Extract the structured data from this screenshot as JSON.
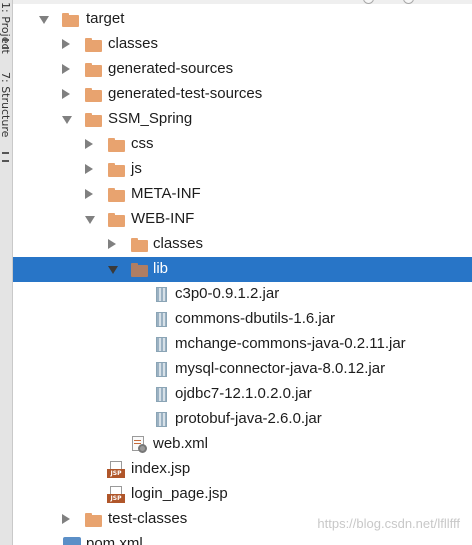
{
  "side_panel": {
    "project_tab": "1: Project",
    "structure_tab": "7: Structure"
  },
  "tree": [
    {
      "label": "target",
      "icon": "folder-icon",
      "state": "expanded"
    },
    {
      "label": "classes",
      "icon": "folder-icon",
      "state": "collapsed"
    },
    {
      "label": "generated-sources",
      "icon": "folder-icon",
      "state": "collapsed"
    },
    {
      "label": "generated-test-sources",
      "icon": "folder-icon",
      "state": "collapsed"
    },
    {
      "label": "SSM_Spring",
      "icon": "folder-icon",
      "state": "expanded"
    },
    {
      "label": "css",
      "icon": "folder-icon",
      "state": "collapsed"
    },
    {
      "label": "js",
      "icon": "folder-icon",
      "state": "collapsed"
    },
    {
      "label": "META-INF",
      "icon": "folder-icon",
      "state": "collapsed"
    },
    {
      "label": "WEB-INF",
      "icon": "folder-icon",
      "state": "expanded"
    },
    {
      "label": "classes",
      "icon": "folder-icon",
      "state": "collapsed"
    },
    {
      "label": "lib",
      "icon": "folder-icon",
      "state": "expanded",
      "selected": true
    },
    {
      "label": "c3p0-0.9.1.2.jar",
      "icon": "jar-icon"
    },
    {
      "label": "commons-dbutils-1.6.jar",
      "icon": "jar-icon"
    },
    {
      "label": "mchange-commons-java-0.2.11.jar",
      "icon": "jar-icon"
    },
    {
      "label": "mysql-connector-java-8.0.12.jar",
      "icon": "jar-icon"
    },
    {
      "label": "ojdbc7-12.1.0.2.0.jar",
      "icon": "jar-icon"
    },
    {
      "label": "protobuf-java-2.6.0.jar",
      "icon": "jar-icon"
    },
    {
      "label": "web.xml",
      "icon": "xml-file-icon"
    },
    {
      "label": "index.jsp",
      "icon": "jsp-file-icon",
      "badge": "JSP"
    },
    {
      "label": "login_page.jsp",
      "icon": "jsp-file-icon",
      "badge": "JSP"
    },
    {
      "label": "test-classes",
      "icon": "folder-icon",
      "state": "collapsed"
    },
    {
      "label": "pom.xml",
      "icon": "maven-icon"
    }
  ],
  "colors": {
    "selection": "#2875c7",
    "folder": "#e8a36f",
    "folder_selected": "#b07e63"
  },
  "watermark": "https://blog.csdn.net/lfllfff"
}
